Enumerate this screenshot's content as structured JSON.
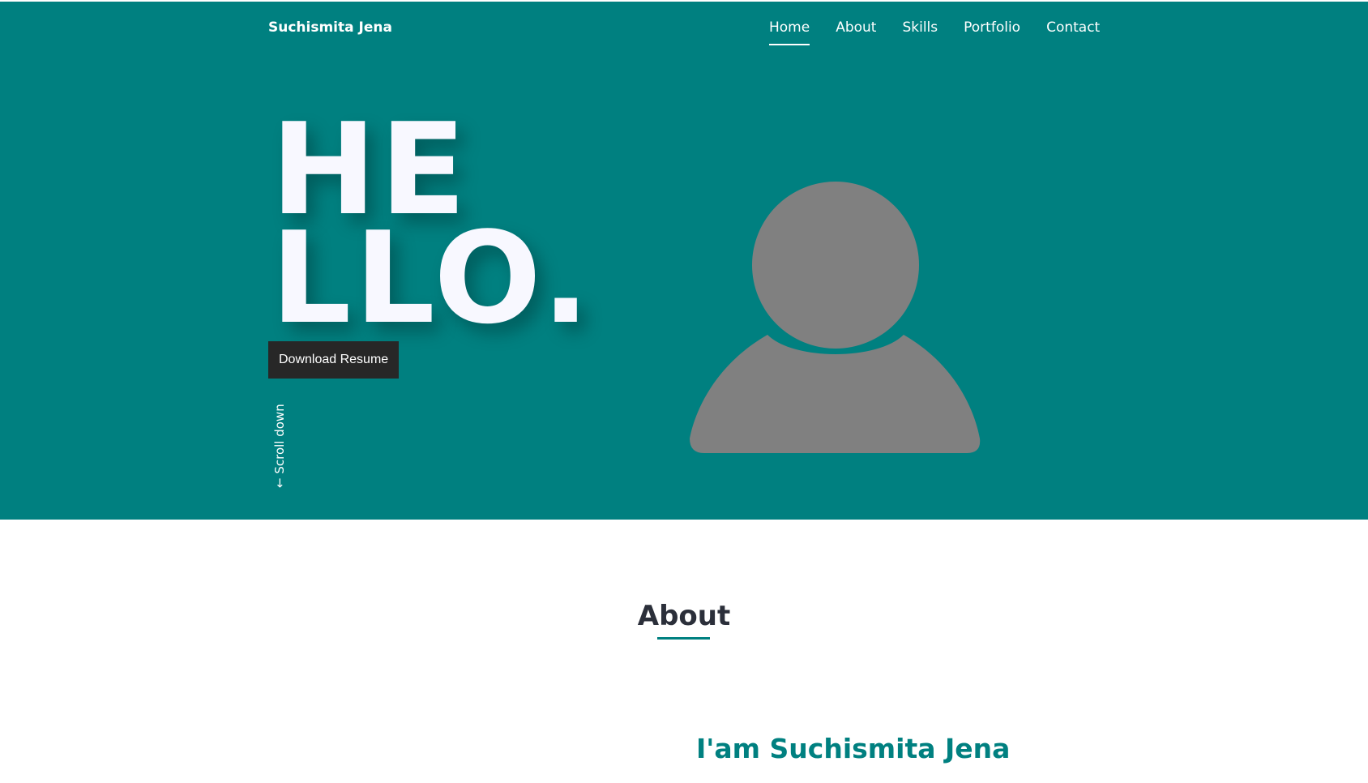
{
  "header": {
    "brand": "Suchismita Jena",
    "nav": [
      {
        "label": "Home",
        "active": true
      },
      {
        "label": "About",
        "active": false
      },
      {
        "label": "Skills",
        "active": false
      },
      {
        "label": "Portfolio",
        "active": false
      },
      {
        "label": "Contact",
        "active": false
      }
    ]
  },
  "hero": {
    "hello_line1": "HE",
    "hello_line2": "LLO.",
    "download_label": "Download Resume",
    "scroll_label": "← Scroll down",
    "avatar_icon": "user-silhouette-icon"
  },
  "about": {
    "title": "About",
    "intro": "I'am Suchismita Jena"
  },
  "colors": {
    "hero_bg": "#008080",
    "accent": "#008080",
    "button_bg": "#272727",
    "avatar": "#808080",
    "heading": "#2b2f3a"
  }
}
